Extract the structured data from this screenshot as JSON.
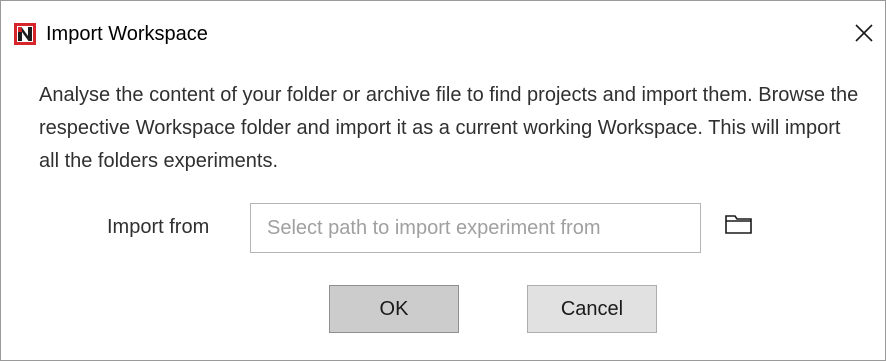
{
  "window": {
    "title": "Import Workspace",
    "app_icon": "app-logo-icon",
    "close_icon": "close-icon"
  },
  "description": "Analyse the content of your folder or archive file to find projects and import them. Browse the respective Workspace folder and import it as a current working Workspace. This will import all the folders experiments.",
  "form": {
    "import_from_label": "Import from",
    "path_value": "",
    "path_placeholder": "Select path to import experiment from",
    "browse_icon": "folder-icon"
  },
  "buttons": {
    "ok_label": "OK",
    "cancel_label": "Cancel"
  },
  "colors": {
    "app_icon_red": "#d7262b",
    "app_icon_dark": "#1c1c1c",
    "ok_bg": "#cccccc",
    "cancel_bg": "#e1e1e1"
  }
}
